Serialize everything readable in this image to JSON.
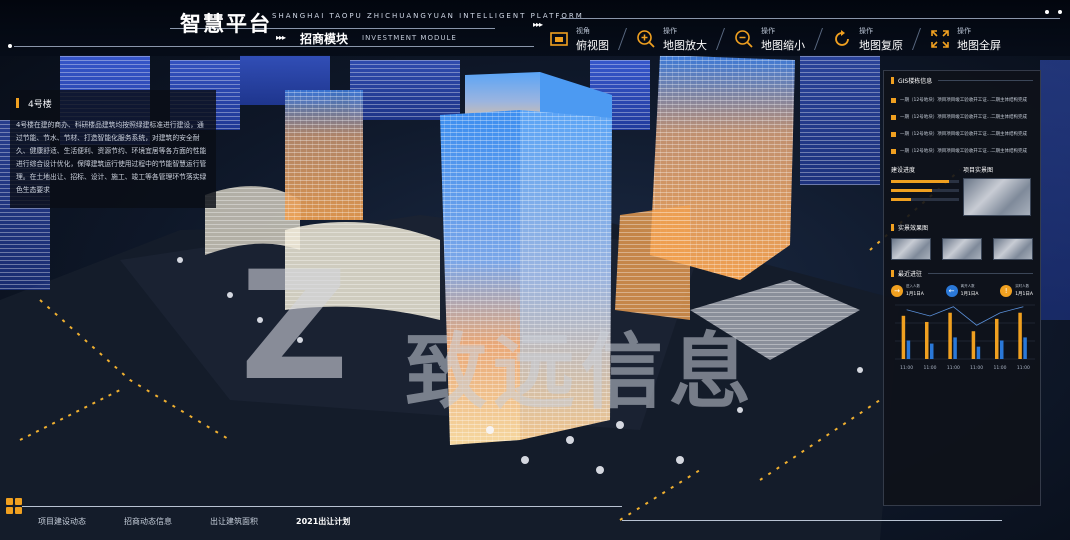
{
  "header": {
    "title": "智慧平台",
    "title_en": "SHANGHAI TAOPU ZHICHUANGYUAN INTELLIGENT PLATFORM",
    "module_name": "招商模块",
    "module_en": "INVESTMENT MODULE"
  },
  "toolbar": [
    {
      "caption": "视角",
      "label": "俯视图",
      "icon": "top-view-icon"
    },
    {
      "caption": "操作",
      "label": "地图放大",
      "icon": "zoom-in-icon"
    },
    {
      "caption": "操作",
      "label": "地图缩小",
      "icon": "zoom-out-icon"
    },
    {
      "caption": "操作",
      "label": "地图复原",
      "icon": "reset-icon"
    },
    {
      "caption": "操作",
      "label": "地图全屏",
      "icon": "fullscreen-icon"
    }
  ],
  "info_panel": {
    "title": "4号楼",
    "description": "4号楼在建的商办、科研楼品建筑均按照绿建标准进行建设，通过节能、节水、节材、打造智能化服务系统，对建筑的安全耐久、健康舒适、生活便利、资源节约、环境宜居等各方面的性能进行综合设计优化，保障建筑运行使用过程中的节能智慧运行管理。在土地出让、招标、设计、施工、竣工等各管理环节落实绿色生态要求"
  },
  "right_panel": {
    "title": "GIS楼栋信息",
    "news": [
      "一期（12号地块）项目项目竣工验收开工证...二期主体结构完成",
      "一期（12号地块）项目项目竣工验收开工证...二期主体结构完成",
      "一期（12号地块）项目项目竣工验收开工证...二期主体结构完成",
      "一期（12号地块）项目项目竣工验收开工证...二期主体结构完成"
    ],
    "progress_title": "建设进度",
    "progress": [
      {
        "label": "",
        "value": 0.85
      },
      {
        "label": "",
        "value": 0.6
      },
      {
        "label": "",
        "value": 0.3
      }
    ],
    "photo_title": "项目实景图",
    "thumbs_title": "实景效果图",
    "counts_title": "最近进驻",
    "counts": [
      {
        "label": "进入人数",
        "value": "1月1日A",
        "color": "#f0a020",
        "icon": "arrow-right-icon"
      },
      {
        "label": "离开人数",
        "value": "1月1日A",
        "color": "#2a78d8",
        "icon": "arrow-left-icon"
      },
      {
        "label": "实时人数",
        "value": "1月1日A",
        "color": "#f0a020",
        "icon": "alert-icon"
      }
    ]
  },
  "chart_data": {
    "type": "bar",
    "categories": [
      "11:00",
      "11:00",
      "11:00",
      "11:00",
      "11:00",
      "11:00"
    ],
    "series": [
      {
        "values": [
          28,
          24,
          30,
          18,
          26,
          30
        ]
      },
      {
        "values": [
          12,
          10,
          14,
          8,
          12,
          14
        ]
      }
    ],
    "ylim": [
      0,
      35
    ],
    "colors": [
      "#f0a020",
      "#2a78d8"
    ]
  },
  "bottom_tabs": [
    {
      "label": "项目建设动态",
      "active": false
    },
    {
      "label": "招商动态信息",
      "active": false
    },
    {
      "label": "出让建筑面积",
      "active": false
    },
    {
      "label": "2021出让计划",
      "active": true
    }
  ],
  "watermark": {
    "glyph": "Z",
    "text": "致远信息"
  }
}
